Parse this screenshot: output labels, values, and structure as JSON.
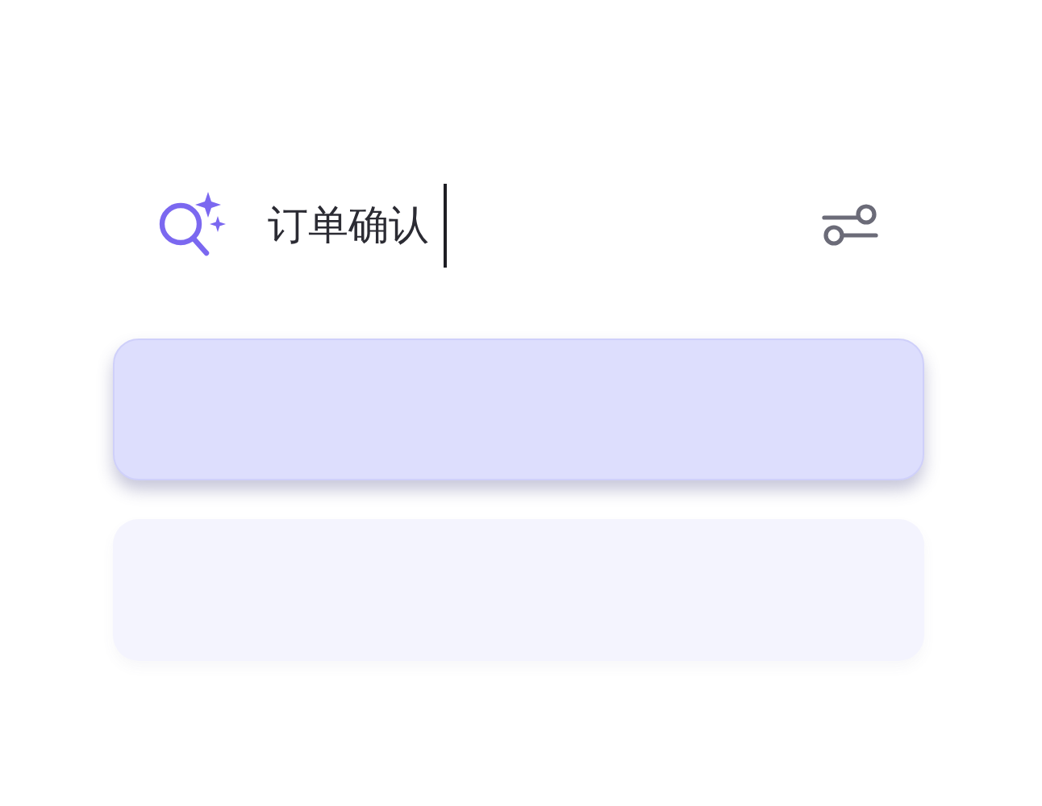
{
  "search": {
    "value": "订单确认",
    "focused": true
  },
  "results": [
    {
      "selected": true
    },
    {
      "selected": false
    }
  ]
}
